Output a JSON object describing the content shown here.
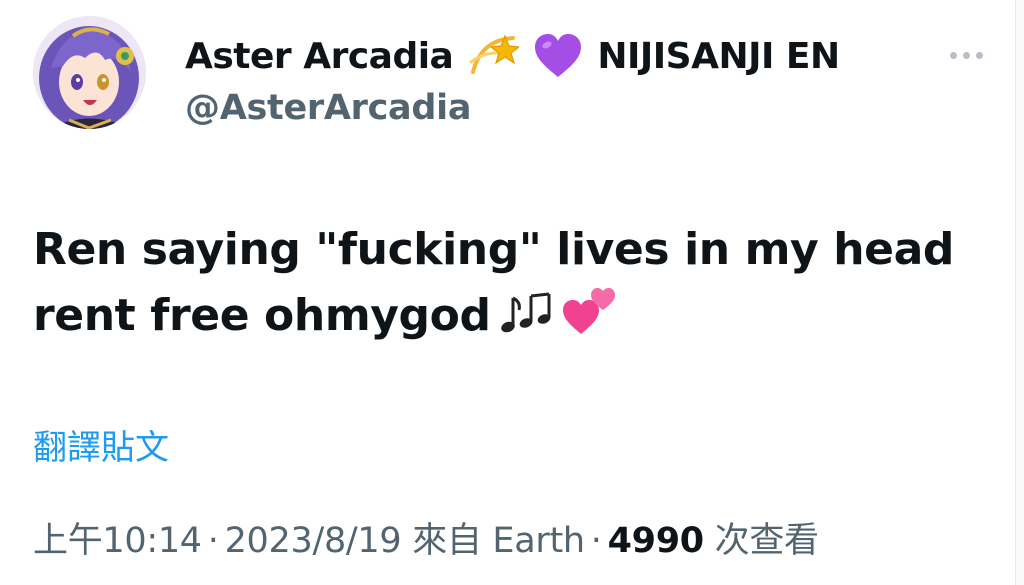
{
  "author": {
    "display_name": "Aster Arcadia",
    "affiliation": "NIJISANJI EN",
    "handle": "@AsterArcadia",
    "name_emojis": [
      "dizzy-star-emoji",
      "purple-heart-emoji"
    ]
  },
  "tweet": {
    "text_line_1": "Ren saying \"fucking\" lives in my head",
    "text_line_2": "rent free ohmygod",
    "text_emojis": [
      "musical-notes-emoji",
      "two-hearts-emoji"
    ]
  },
  "translate_label": "翻譯貼文",
  "meta": {
    "time": "上午10:14",
    "date": "2023/8/19",
    "source_prefix": "來自",
    "source": "Earth",
    "separator": "·",
    "views_count": "4990",
    "views_label": "次查看"
  },
  "colors": {
    "text_primary": "#0f1419",
    "text_secondary": "#536471",
    "link": "#1d9bf0"
  }
}
